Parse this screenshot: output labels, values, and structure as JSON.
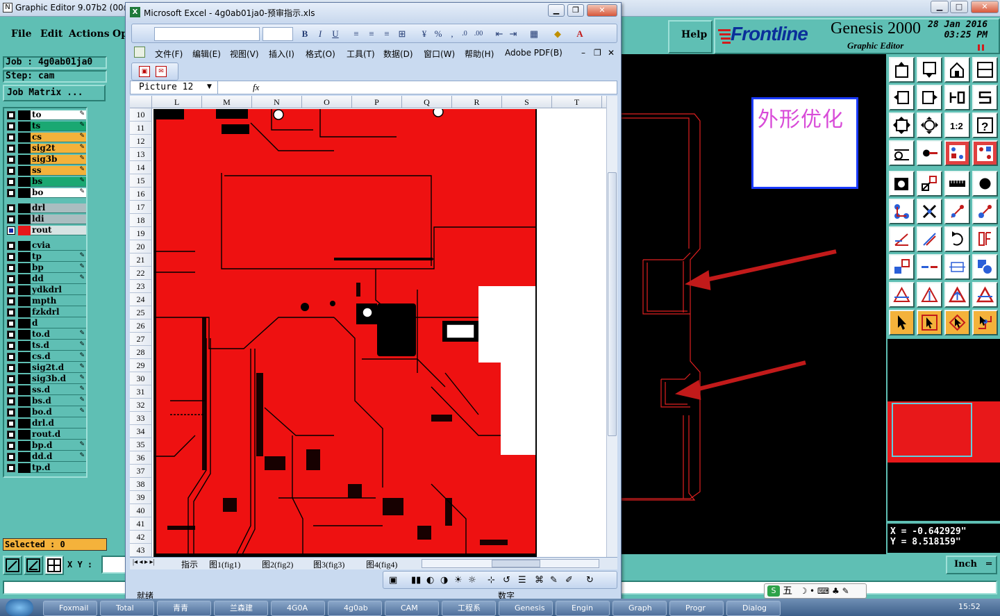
{
  "genesis": {
    "title": "Graphic Editor 9.07b2 (00@",
    "menus": [
      "File",
      "Edit",
      "Actions",
      "Op"
    ],
    "help_label": "Help",
    "logo_text": "Frontline",
    "product": "Genesis 2000",
    "subtitle": "Graphic Editor",
    "date": "28 Jan 2016",
    "time": "03:25 PM",
    "job_label": "Job : 4g0ab01ja0",
    "step_label": "Step: cam",
    "job_matrix_label": "Job Matrix ...",
    "selected_label": "Selected : 0",
    "xy_label": "X Y :",
    "units_label": "Inch",
    "coord_x": "X = -0.642929\"",
    "coord_y": "Y = 8.518159\"",
    "annotation_text": "外形优化"
  },
  "layers": [
    {
      "name": "to",
      "color": "#ffffff",
      "edit": true
    },
    {
      "name": "ts",
      "color": "#1aa872",
      "edit": true
    },
    {
      "name": "cs",
      "color": "#f4b23b",
      "edit": true
    },
    {
      "name": "sig2t",
      "color": "#f4b23b",
      "edit": true
    },
    {
      "name": "sig3b",
      "color": "#f4b23b",
      "edit": true
    },
    {
      "name": "ss",
      "color": "#f4b23b",
      "edit": true
    },
    {
      "name": "bs",
      "color": "#1aa872",
      "edit": true
    },
    {
      "name": "bo",
      "color": "#ffffff",
      "edit": true
    },
    {
      "name": "drl",
      "color": "#aabdc0",
      "edit": false
    },
    {
      "name": "ldi",
      "color": "#aabdc0",
      "edit": false
    },
    {
      "name": "rout",
      "color": "#d7e3e3",
      "edit": false,
      "active": true
    },
    {
      "name": "cvia",
      "color": "#5fbfb4",
      "edit": false
    },
    {
      "name": "tp",
      "color": "#5fbfb4",
      "edit": true
    },
    {
      "name": "bp",
      "color": "#5fbfb4",
      "edit": true
    },
    {
      "name": "dd",
      "color": "#5fbfb4",
      "edit": true
    },
    {
      "name": "ydkdrl",
      "color": "#5fbfb4",
      "edit": false
    },
    {
      "name": "mpth",
      "color": "#5fbfb4",
      "edit": false
    },
    {
      "name": "fzkdrl",
      "color": "#5fbfb4",
      "edit": false
    },
    {
      "name": "d",
      "color": "#5fbfb4",
      "edit": false
    },
    {
      "name": "to.d",
      "color": "#5fbfb4",
      "edit": true
    },
    {
      "name": "ts.d",
      "color": "#5fbfb4",
      "edit": true
    },
    {
      "name": "cs.d",
      "color": "#5fbfb4",
      "edit": true
    },
    {
      "name": "sig2t.d",
      "color": "#5fbfb4",
      "edit": true
    },
    {
      "name": "sig3b.d",
      "color": "#5fbfb4",
      "edit": true
    },
    {
      "name": "ss.d",
      "color": "#5fbfb4",
      "edit": true
    },
    {
      "name": "bs.d",
      "color": "#5fbfb4",
      "edit": true
    },
    {
      "name": "bo.d",
      "color": "#5fbfb4",
      "edit": true
    },
    {
      "name": "drl.d",
      "color": "#5fbfb4",
      "edit": false
    },
    {
      "name": "rout.d",
      "color": "#5fbfb4",
      "edit": false
    },
    {
      "name": "bp.d",
      "color": "#5fbfb4",
      "edit": true
    },
    {
      "name": "dd.d",
      "color": "#5fbfb4",
      "edit": true
    },
    {
      "name": "tp.d",
      "color": "#5fbfb4",
      "edit": false
    }
  ],
  "excel": {
    "title": "Microsoft Excel - 4g0ab01ja0-预审指示.xls",
    "menus": [
      "文件(F)",
      "编辑(E)",
      "视图(V)",
      "插入(I)",
      "格式(O)",
      "工具(T)",
      "数据(D)",
      "窗口(W)",
      "帮助(H)",
      "Adobe PDF(B)"
    ],
    "name_box": "Picture 12",
    "fx": "fx",
    "columns": [
      "L",
      "M",
      "N",
      "O",
      "P",
      "Q",
      "R",
      "S",
      "T"
    ],
    "rows": [
      "10",
      "11",
      "12",
      "13",
      "14",
      "15",
      "16",
      "17",
      "18",
      "19",
      "20",
      "21",
      "22",
      "23",
      "24",
      "25",
      "26",
      "27",
      "28",
      "29",
      "30",
      "31",
      "32",
      "33",
      "34",
      "35",
      "36",
      "37",
      "38",
      "39",
      "40",
      "41",
      "42",
      "43"
    ],
    "sheet_tabs": [
      "指示",
      "图1(fig1)",
      "图2(fig2)",
      "图3(fig3)",
      "图4(fig4)"
    ],
    "status_left": "就绪",
    "status_right": "数字"
  },
  "taskbar": {
    "items": [
      "Foxmail",
      "Total",
      "青青",
      "兰森建",
      "4G0A",
      "4g0ab",
      "CAM",
      "工程系",
      "Genesis",
      "Engin",
      "Graph",
      "Progr",
      "Dialog"
    ],
    "clock": "15:52",
    "ime_label": "五"
  }
}
